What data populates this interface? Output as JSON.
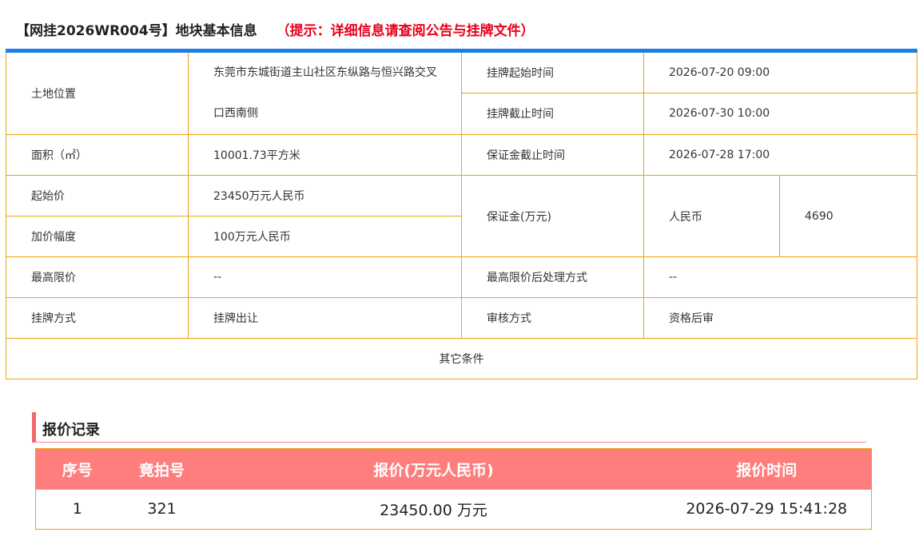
{
  "header": {
    "title": "【网挂2026WR004号】地块基本信息",
    "hint": "（提示：详细信息请查阅公告与挂牌文件）"
  },
  "info": {
    "location_label": "土地位置",
    "location_line1": "东莞市东城街道主山社区东纵路与恒兴路交叉",
    "location_line2": "口西南侧",
    "listing_start_label": "挂牌起始时间",
    "listing_start_value": "2026-07-20 09:00",
    "listing_end_label": "挂牌截止时间",
    "listing_end_value": "2026-07-30 10:00",
    "area_label": "面积（㎡）",
    "area_value": "10001.73平方米",
    "deposit_deadline_label": "保证金截止时间",
    "deposit_deadline_value": "2026-07-28 17:00",
    "start_price_label": "起始价",
    "start_price_value": "23450万元人民币",
    "deposit_label": "保证金(万元)",
    "deposit_currency": "人民币",
    "deposit_amount": "4690",
    "increment_label": "加价幅度",
    "increment_value": "100万元人民币",
    "max_price_label": "最高限价",
    "max_price_value": "--",
    "max_price_handling_label": "最高限价后处理方式",
    "max_price_handling_value": "--",
    "listing_method_label": "挂牌方式",
    "listing_method_value": "挂牌出让",
    "review_method_label": "审核方式",
    "review_method_value": "资格后审",
    "other_conditions_label": "其它条件"
  },
  "quotes": {
    "heading": "报价记录",
    "columns": [
      "序号",
      "竟拍号",
      "报价(万元人民币)",
      "报价时间"
    ],
    "rows": [
      [
        "1",
        "321",
        "23450.00 万元",
        "2026-07-29 15:41:28"
      ]
    ]
  },
  "colors": {
    "accent_blue": "#1e7ee6",
    "border_orange": "#f0a30a",
    "hint_red": "#e8001a",
    "quote_header_bg": "#fe7e7d"
  }
}
